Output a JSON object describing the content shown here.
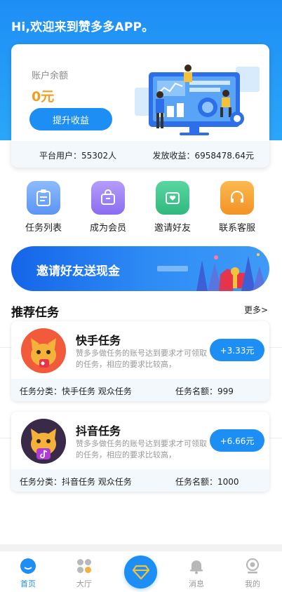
{
  "header": {
    "greeting": "Hi,欢迎来到赞多多APP。"
  },
  "balance_card": {
    "balance_label": "账户余额",
    "balance_value": "0元",
    "withdraw_button": "提升收益",
    "stat_users": "平台用户：55302人",
    "stat_payout": "发放收益：6958478.64元"
  },
  "quick_actions": [
    {
      "label": "任务列表",
      "icon": "clipboard-icon",
      "color": "#6aa3f8"
    },
    {
      "label": "成为会员",
      "icon": "shopping-bag-icon",
      "color": "#9b7cf4"
    },
    {
      "label": "邀请好友",
      "icon": "heart-mail-icon",
      "color": "#3cc78e"
    },
    {
      "label": "联系客服",
      "icon": "headset-icon",
      "color": "#f5a23a"
    }
  ],
  "banner": {
    "text": "邀请好友送现金"
  },
  "section": {
    "title": "推荐任务",
    "more": "更多>"
  },
  "tasks": [
    {
      "name": "快手任务",
      "desc": "赞多多做任务的账号达到要求才可领取的任务，相应的要求比较高，",
      "reward": "+3.33元",
      "category": "任务分类：快手任务 观众任务",
      "quota": "任务名额：999",
      "avatar_icon": "kuaishou-cat-icon",
      "avatar_color": "#f15a3a"
    },
    {
      "name": "抖音任务",
      "desc": "赞多多做任务的账号达到要求才可领取的任务，相应的要求比较高，",
      "reward": "+6.66元",
      "category": "任务分类：抖音任务 观众任务",
      "quota": "任务名额：1000",
      "avatar_icon": "douyin-cat-icon",
      "avatar_color": "#3a2a4a"
    }
  ],
  "tabbar": {
    "items": [
      {
        "label": "首页",
        "icon": "home-icon",
        "active": true
      },
      {
        "label": "大厅",
        "icon": "grid-dots-icon",
        "active": false
      },
      {
        "label": "",
        "icon": "diamond-icon",
        "active": false
      },
      {
        "label": "消息",
        "icon": "bell-icon",
        "active": false
      },
      {
        "label": "我的",
        "icon": "user-icon",
        "active": false
      }
    ]
  },
  "colors": {
    "primary": "#1c8ef4",
    "accent_orange": "#f39c1f"
  }
}
